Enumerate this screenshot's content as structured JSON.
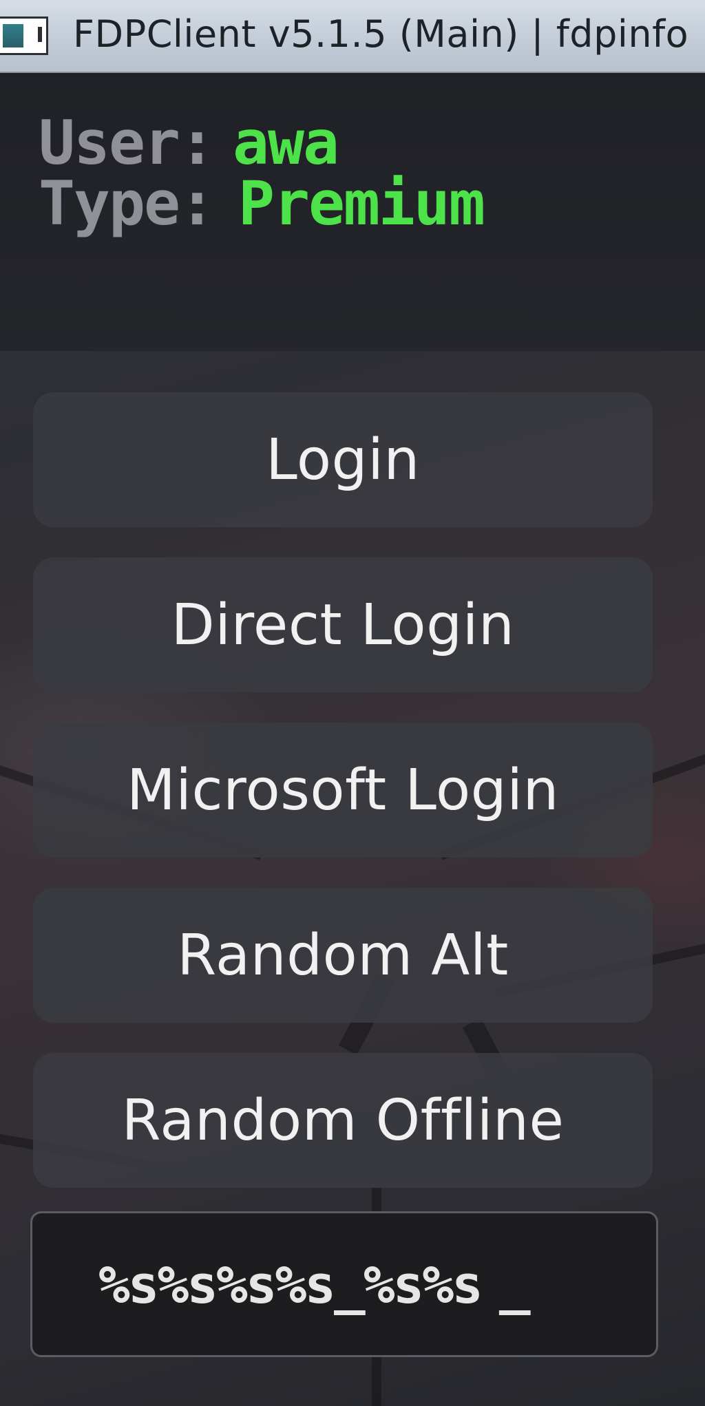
{
  "window": {
    "title": "FDPClient v5.1.5 (Main) | fdpinfo",
    "icon": "app-window-icon"
  },
  "account": {
    "user_label": "User:",
    "user_value": "awa",
    "type_label": "Type:",
    "type_value": "Premium",
    "value_color": "#4de24a"
  },
  "buttons": {
    "login": "Login",
    "direct_login": "Direct Login",
    "microsoft_login": "Microsoft Login",
    "random_alt": "Random Alt",
    "random_offline": "Random Offline"
  },
  "username_input": {
    "value": "%s%s%s%s_%s%s",
    "caret": "_"
  }
}
